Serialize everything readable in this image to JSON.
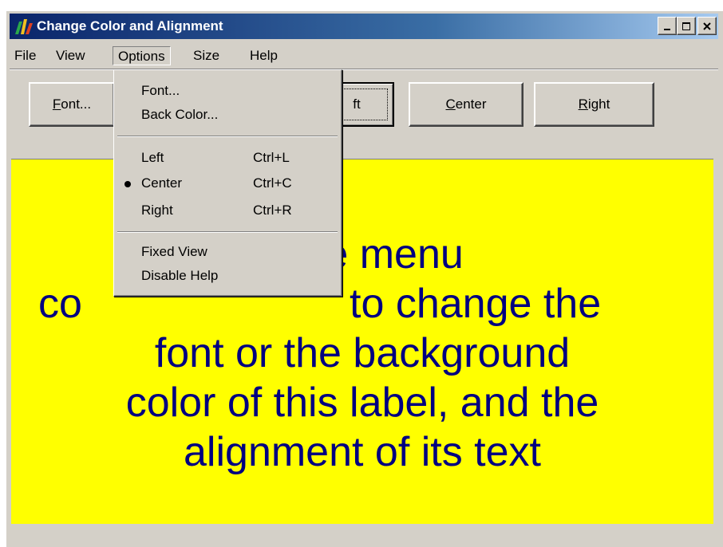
{
  "window": {
    "title": "Change Color and Alignment",
    "controls": {
      "minimize": "_",
      "maximize": "□",
      "close": "x"
    }
  },
  "menubar": [
    {
      "label": "File"
    },
    {
      "label": "View"
    },
    {
      "label": "Options",
      "open": true
    },
    {
      "label": "Size"
    },
    {
      "label": "Help"
    }
  ],
  "toolbar": {
    "font_prefix": "F",
    "font_rest": "ont...",
    "left_visible": "ft",
    "center_prefix": "C",
    "center_rest": "enter",
    "right_prefix": "R",
    "right_rest": "ight"
  },
  "options_menu": {
    "font": "Font...",
    "back_color": "Back Color...",
    "left": {
      "label": "Left",
      "accel": "Ctrl+L"
    },
    "center": {
      "label": "Center",
      "accel": "Ctrl+C",
      "checked": true
    },
    "right": {
      "label": "Right",
      "accel": "Ctrl+R"
    },
    "fixed_view": "Fixed View",
    "disable_help": "Disable Help"
  },
  "label": {
    "line1": "the menu",
    "line2_a": "co",
    "line2_b": "to change the",
    "line3": "font or the background",
    "line4": "color of this label, and the",
    "line5": "alignment of its text",
    "background": "#ffff00",
    "text_color": "#000080"
  }
}
